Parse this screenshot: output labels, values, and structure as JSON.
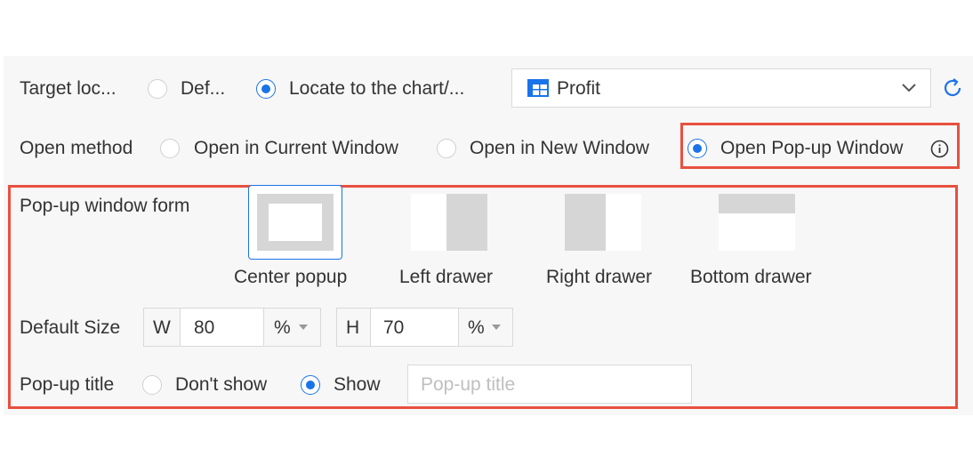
{
  "target_location": {
    "label": "Target loc...",
    "options": [
      {
        "label": "Def...",
        "checked": false
      },
      {
        "label": "Locate to the chart/...",
        "checked": true
      }
    ],
    "chart_select": {
      "value": "Profit",
      "icon": "table-chart-icon"
    },
    "refresh_icon": "refresh-icon"
  },
  "open_method": {
    "label": "Open method",
    "options": [
      {
        "label": "Open in Current Window",
        "checked": false
      },
      {
        "label": "Open in New Window",
        "checked": false
      },
      {
        "label": "Open Pop-up Window",
        "checked": true
      }
    ],
    "info_icon": "info-icon"
  },
  "popup_form": {
    "label": "Pop-up window form",
    "options": [
      {
        "label": "Center popup",
        "selected": true
      },
      {
        "label": "Left drawer",
        "selected": false
      },
      {
        "label": "Right drawer",
        "selected": false
      },
      {
        "label": "Bottom drawer",
        "selected": false
      }
    ]
  },
  "default_size": {
    "label": "Default Size",
    "width": {
      "prefix": "W",
      "value": "80",
      "unit": "%"
    },
    "height": {
      "prefix": "H",
      "value": "70",
      "unit": "%"
    }
  },
  "popup_title": {
    "label": "Pop-up title",
    "options": [
      {
        "label": "Don't show",
        "checked": false
      },
      {
        "label": "Show",
        "checked": true
      }
    ],
    "input_placeholder": "Pop-up title"
  },
  "colors": {
    "accent": "#1a73e8",
    "highlight": "#e8503f",
    "panel_bg": "#f7f7f7"
  }
}
